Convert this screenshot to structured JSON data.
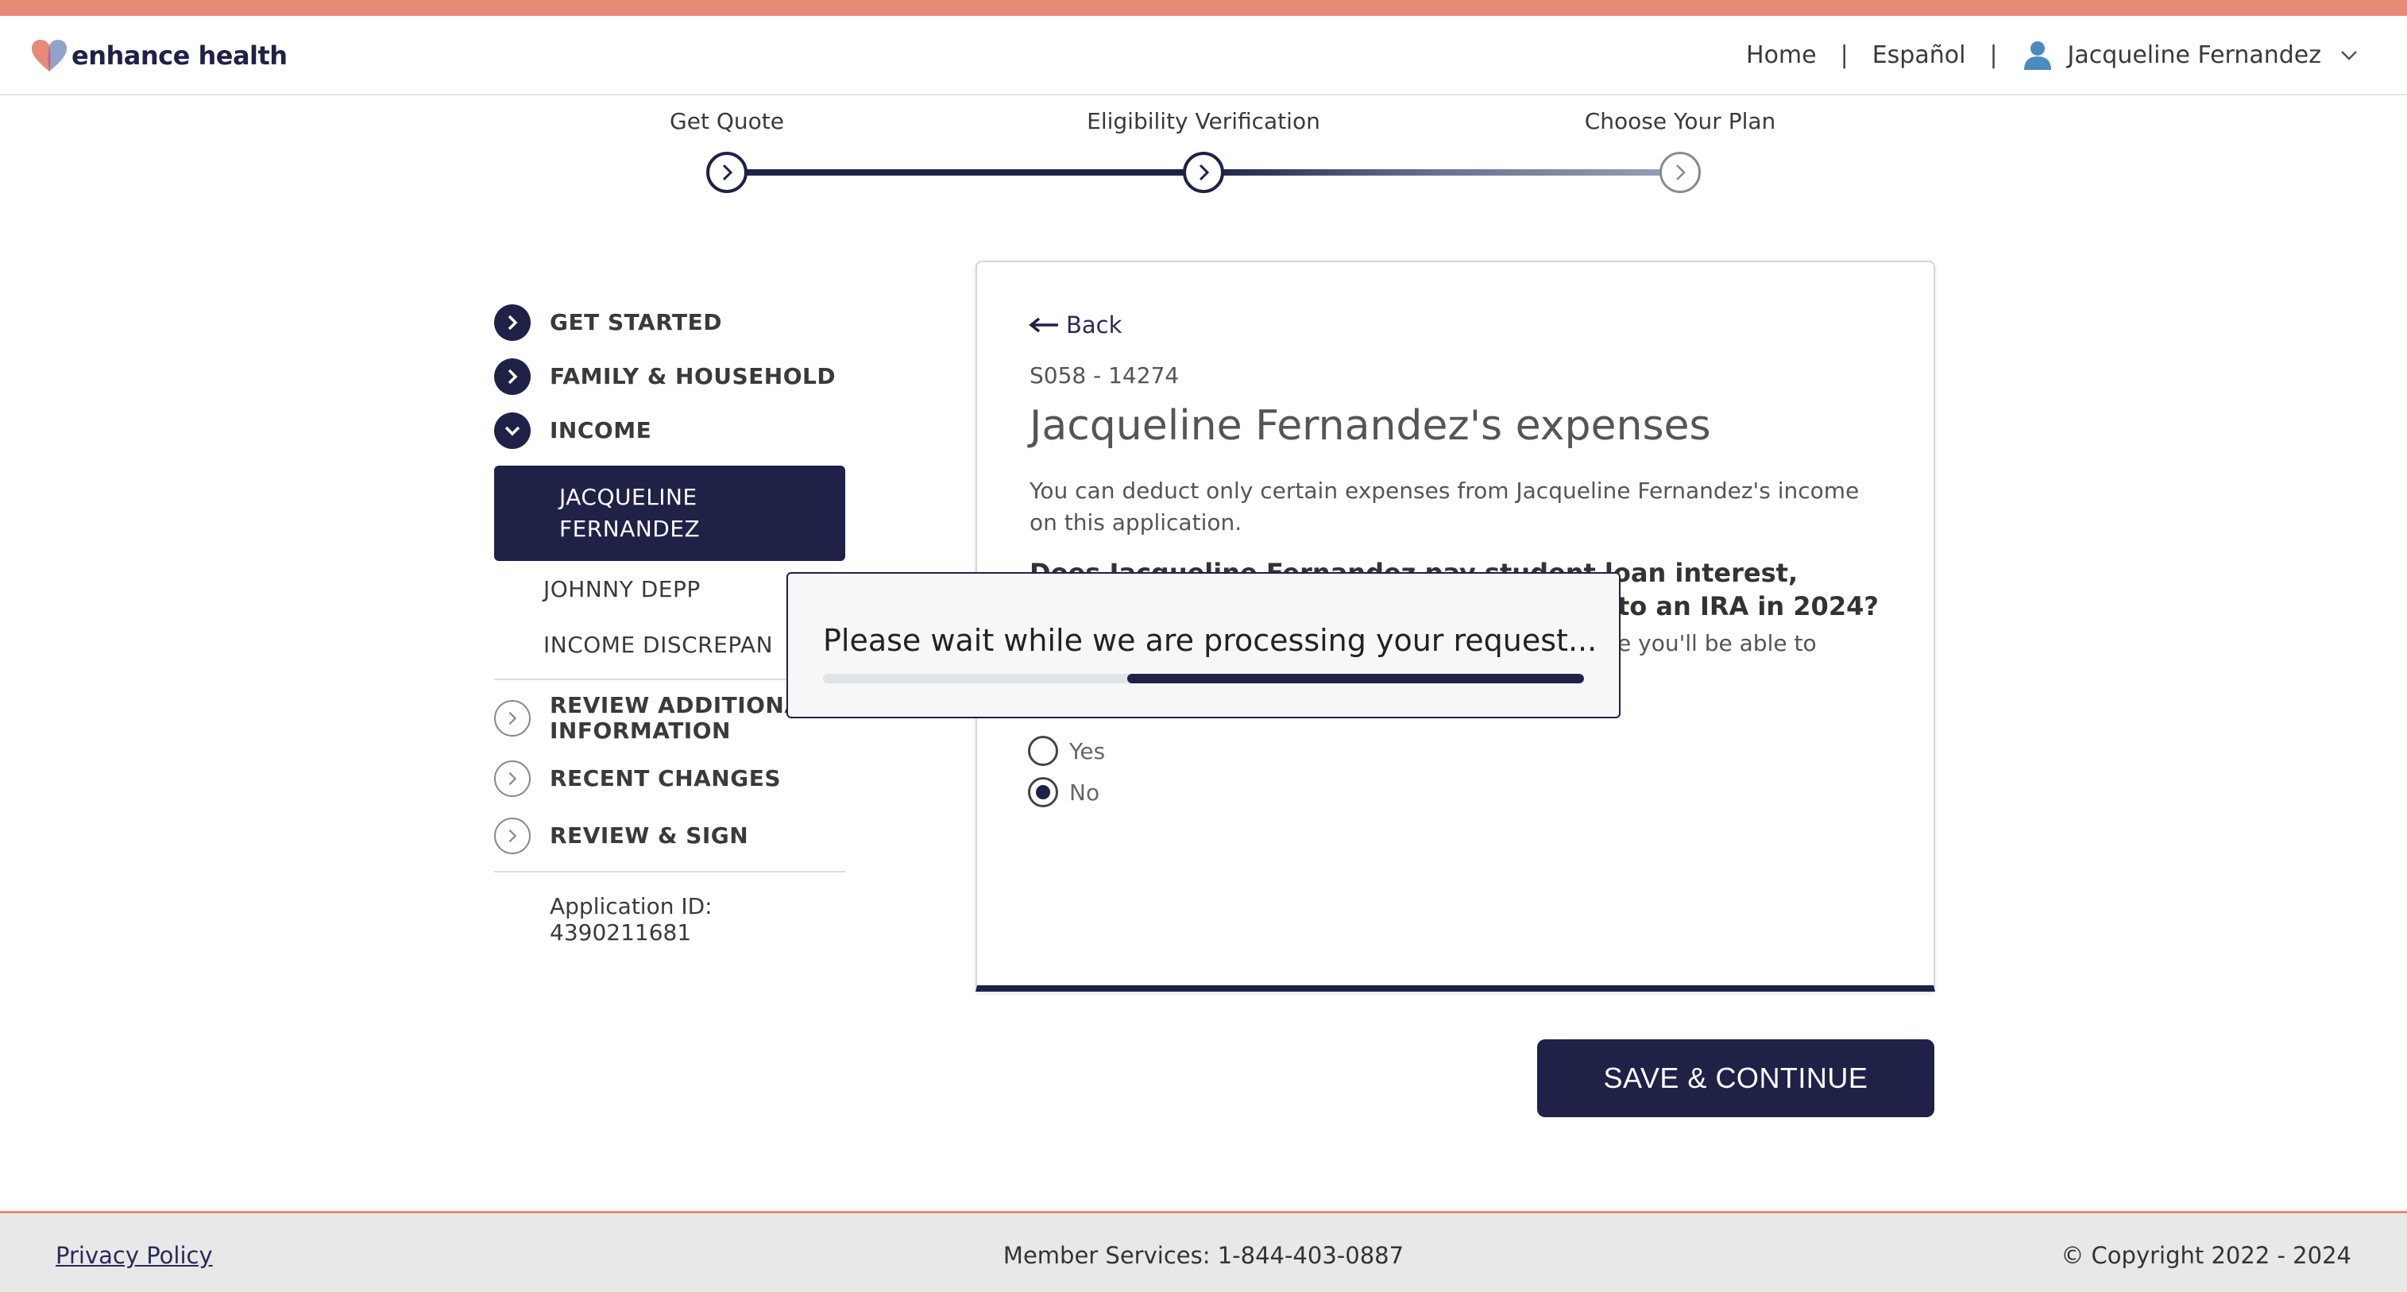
{
  "header": {
    "logo_text": "enhance health",
    "nav": {
      "home": "Home",
      "separator": "|",
      "language": "Español",
      "user_name": "Jacqueline Fernandez"
    }
  },
  "stepper": {
    "steps": [
      {
        "label": "Get Quote"
      },
      {
        "label": "Eligibility Verification"
      },
      {
        "label": "Choose Your Plan"
      }
    ]
  },
  "sidebar": {
    "get_started": "GET STARTED",
    "family_household": "FAMILY & HOUSEHOLD",
    "income": "INCOME",
    "active_member_line1": "JACQUELINE",
    "active_member_line2": "FERNANDEZ",
    "member_2": "JOHNNY DEPP",
    "income_discrepancy": "INCOME DISCREPAN",
    "review_additional_line1": "REVIEW ADDITIONAL",
    "review_additional_line2": "INFORMATION",
    "recent_changes": "RECENT CHANGES",
    "review_sign": "REVIEW & SIGN",
    "application_id": "Application ID: 4390211681"
  },
  "card": {
    "back": "Back",
    "code": "S058 - 14274",
    "title": "Jacqueline Fernandez's expenses",
    "description": "You can deduct only certain expenses from Jacqueline Fernandez's income on this application.",
    "question_line1": "Does Jacqueline Fernandez pay student loan interest,",
    "question_line2": "to an IRA in 2024?",
    "hint": "e you'll be able to",
    "options": {
      "yes": "Yes",
      "no": "No"
    },
    "selected": "No"
  },
  "save_button": "SAVE & CONTINUE",
  "modal": {
    "message": "Please wait while we are processing your request...",
    "progress_start": 0.4,
    "progress_end": 1.0
  },
  "footer": {
    "privacy": "Privacy Policy",
    "member_services": "Member Services: 1-844-403-0887",
    "copyright": "© Copyright 2022 - 2024"
  },
  "colors": {
    "navy": "#1f2147",
    "coral": "#e98a78"
  }
}
